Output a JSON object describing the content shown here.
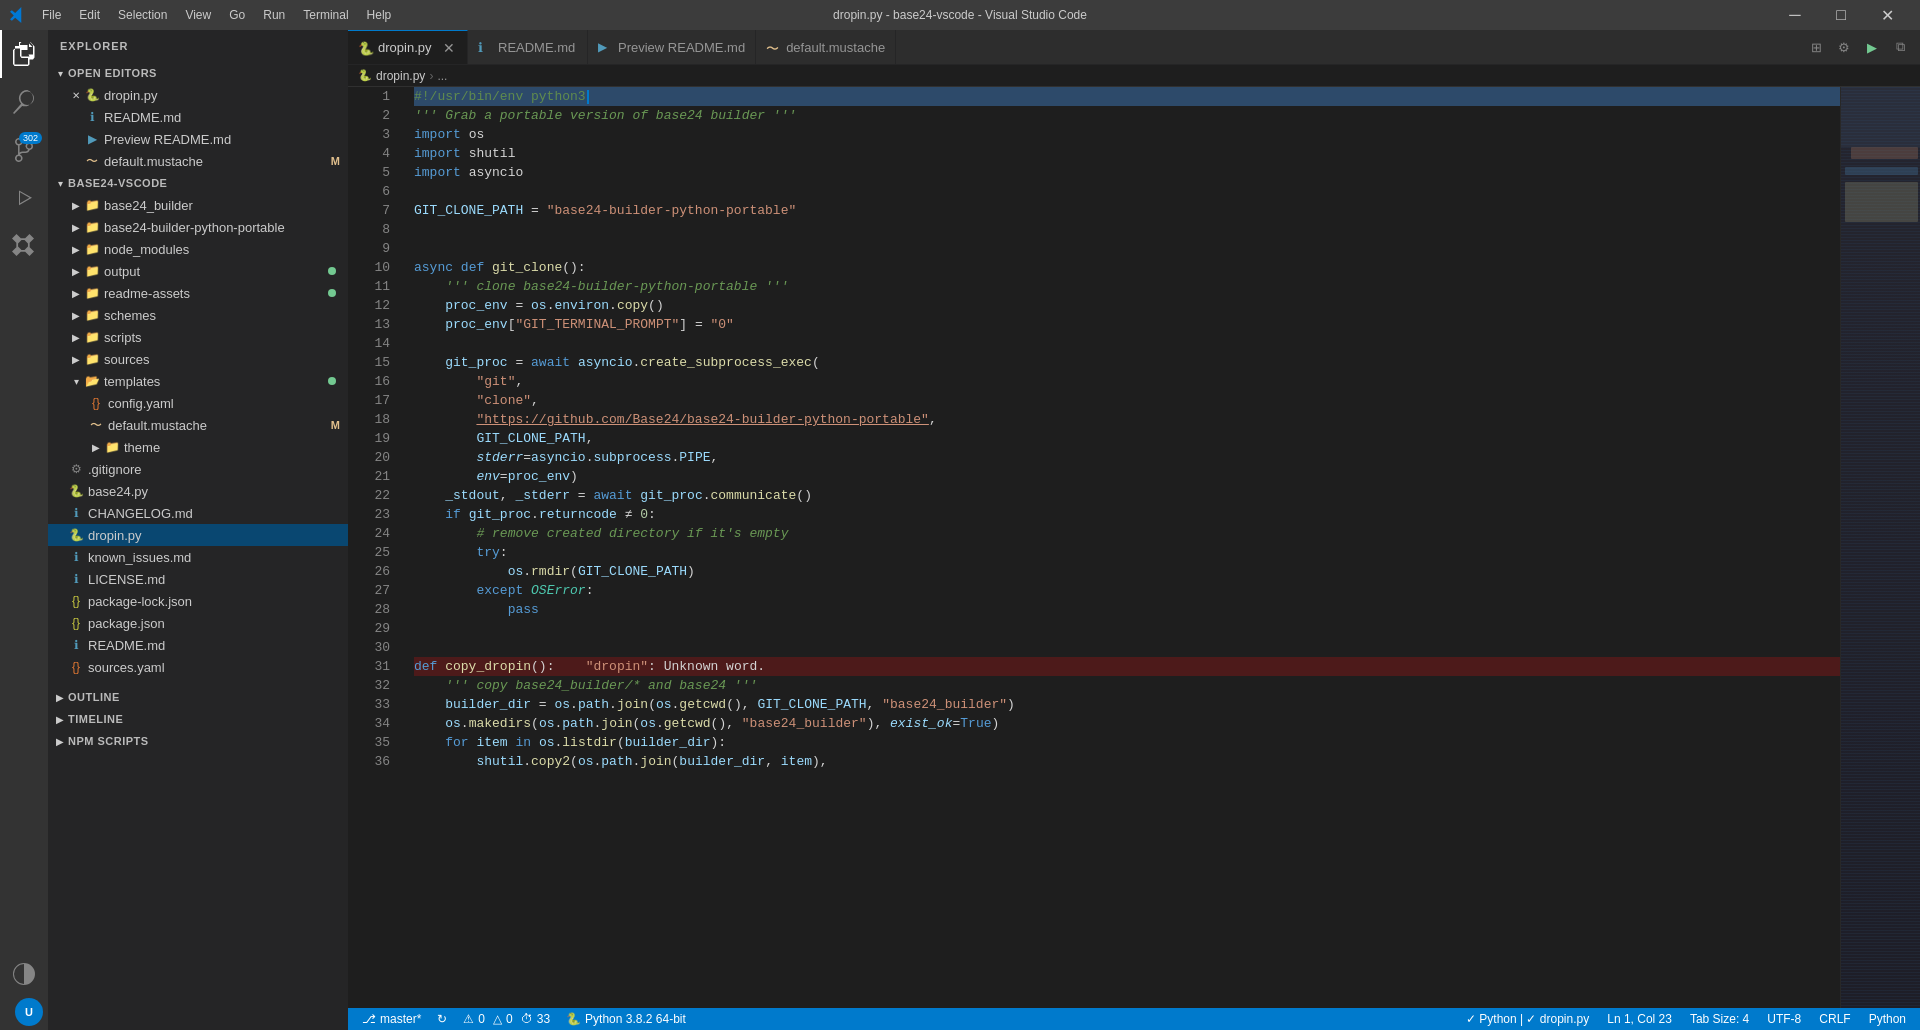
{
  "titlebar": {
    "title": "dropin.py - base24-vscode - Visual Studio Code",
    "menu": [
      "File",
      "Edit",
      "Selection",
      "View",
      "Go",
      "Run",
      "Terminal",
      "Help"
    ],
    "controls": [
      "─",
      "□",
      "✕"
    ]
  },
  "activity_bar": {
    "items": [
      {
        "name": "explorer",
        "icon": "files",
        "active": true
      },
      {
        "name": "search",
        "icon": "search"
      },
      {
        "name": "source-control",
        "icon": "git",
        "badge": "302"
      },
      {
        "name": "run-debug",
        "icon": "run"
      },
      {
        "name": "extensions",
        "icon": "extensions"
      },
      {
        "name": "remote-explorer",
        "icon": "remote"
      }
    ]
  },
  "sidebar": {
    "header": "EXPLORER",
    "open_editors": {
      "label": "OPEN EDITORS",
      "items": [
        {
          "name": "dropin.py",
          "type": "python",
          "active": true
        },
        {
          "name": "README.md",
          "type": "markdown"
        },
        {
          "name": "Preview README.md",
          "type": "preview"
        },
        {
          "name": "default.mustache",
          "type": "mustache",
          "badge": "M"
        }
      ]
    },
    "project": {
      "label": "BASE24-VSCODE",
      "folders": [
        {
          "name": "base24_builder",
          "indent": 1
        },
        {
          "name": "base24-builder-python-portable",
          "indent": 1
        },
        {
          "name": "node_modules",
          "indent": 1
        },
        {
          "name": "output",
          "indent": 1,
          "dot": "#73c991"
        },
        {
          "name": "readme-assets",
          "indent": 1,
          "dot": "#73c991"
        },
        {
          "name": "schemes",
          "indent": 1
        },
        {
          "name": "scripts",
          "indent": 1
        },
        {
          "name": "sources",
          "indent": 1
        },
        {
          "name": "templates",
          "indent": 1,
          "expanded": true,
          "dot": "#73c991"
        },
        {
          "name": "config.yaml",
          "indent": 2,
          "type": "yaml"
        },
        {
          "name": "default.mustache",
          "indent": 2,
          "type": "mustache",
          "badge": "M"
        },
        {
          "name": "theme",
          "indent": 2,
          "type": "folder-expanded"
        },
        {
          "name": ".gitignore",
          "indent": 1,
          "type": "gitignore"
        },
        {
          "name": "base24.py",
          "indent": 1,
          "type": "python"
        },
        {
          "name": "CHANGELOG.md",
          "indent": 1,
          "type": "markdown"
        },
        {
          "name": "dropin.py",
          "indent": 1,
          "type": "python",
          "selected": true
        },
        {
          "name": "known_issues.md",
          "indent": 1,
          "type": "markdown"
        },
        {
          "name": "LICENSE.md",
          "indent": 1,
          "type": "markdown"
        },
        {
          "name": "package-lock.json",
          "indent": 1,
          "type": "json"
        },
        {
          "name": "package.json",
          "indent": 1,
          "type": "json"
        },
        {
          "name": "README.md",
          "indent": 1,
          "type": "markdown"
        },
        {
          "name": "sources.yaml",
          "indent": 1,
          "type": "yaml"
        }
      ]
    },
    "outline": {
      "label": "OUTLINE"
    },
    "timeline": {
      "label": "TIMELINE"
    },
    "npm_scripts": {
      "label": "NPM SCRIPTS"
    }
  },
  "tabs": [
    {
      "label": "dropin.py",
      "type": "python",
      "active": true,
      "closable": true
    },
    {
      "label": "README.md",
      "type": "markdown",
      "active": false
    },
    {
      "label": "Preview README.md",
      "type": "preview",
      "active": false
    },
    {
      "label": "default.mustache",
      "type": "mustache",
      "active": false
    }
  ],
  "breadcrumb": [
    "dropin.py",
    "..."
  ],
  "code": {
    "lines": [
      {
        "n": 1,
        "content": "shebang",
        "text": "#!/usr/bin/env python3"
      },
      {
        "n": 2,
        "content": "comment",
        "text": "''' Grab a portable version of base24 builder '''"
      },
      {
        "n": 3,
        "content": "import",
        "text": "import os"
      },
      {
        "n": 4,
        "content": "import",
        "text": "import shutil"
      },
      {
        "n": 5,
        "content": "import",
        "text": "import asyncio"
      },
      {
        "n": 6,
        "content": "blank"
      },
      {
        "n": 7,
        "content": "assign",
        "text": "GIT_CLONE_PATH = \"base24-builder-python-portable\""
      },
      {
        "n": 8,
        "content": "blank"
      },
      {
        "n": 9,
        "content": "blank"
      },
      {
        "n": 10,
        "content": "funcdef",
        "text": "async def git_clone():"
      },
      {
        "n": 11,
        "content": "docstring",
        "text": "    ''' clone base24-builder-python-portable '''"
      },
      {
        "n": 12,
        "content": "assign2",
        "text": "    proc_env = os.environ.copy()"
      },
      {
        "n": 13,
        "content": "assign3",
        "text": "    proc_env[\"GIT_TERMINAL_PROMPT\"] = \"0\""
      },
      {
        "n": 14,
        "content": "blank"
      },
      {
        "n": 15,
        "content": "assign4",
        "text": "    git_proc = await asyncio.create_subprocess_exec("
      },
      {
        "n": 16,
        "content": "str1",
        "text": "        \"git\","
      },
      {
        "n": 17,
        "content": "str2",
        "text": "        \"clone\","
      },
      {
        "n": 18,
        "content": "str3",
        "text": "        \"https://github.com/Base24/base24-builder-python-portable\","
      },
      {
        "n": 19,
        "content": "var1",
        "text": "        GIT_CLONE_PATH,"
      },
      {
        "n": 20,
        "content": "kw1",
        "text": "        stderr=asyncio.subprocess.PIPE,"
      },
      {
        "n": 21,
        "content": "kw2",
        "text": "        env=proc_env)"
      },
      {
        "n": 22,
        "content": "unpack",
        "text": "    _stdout, _stderr = await git_proc.communicate()"
      },
      {
        "n": 23,
        "content": "if1",
        "text": "    if git_proc.returncode ≠ 0:"
      },
      {
        "n": 24,
        "content": "comment2",
        "text": "        # remove created directory if it's empty"
      },
      {
        "n": 25,
        "content": "try1",
        "text": "        try:"
      },
      {
        "n": 26,
        "content": "rmdir",
        "text": "            os.rmdir(GIT_CLONE_PATH)"
      },
      {
        "n": 27,
        "content": "except1",
        "text": "        except OSError:"
      },
      {
        "n": 28,
        "content": "pass1",
        "text": "            pass"
      },
      {
        "n": 29,
        "content": "blank"
      },
      {
        "n": 30,
        "content": "blank"
      },
      {
        "n": 31,
        "content": "funcdef2",
        "text": "def copy_dropin():    \"dropin\": Unknown word.",
        "error": true
      },
      {
        "n": 32,
        "content": "docstring2",
        "text": "    ''' copy base24_builder/* and base24 '''"
      },
      {
        "n": 33,
        "content": "assign5",
        "text": "    builder_dir = os.path.join(os.getcwd(), GIT_CLONE_PATH, \"base24_builder\")"
      },
      {
        "n": 34,
        "content": "makedirs",
        "text": "    os.makedirs(os.path.join(os.getcwd(), \"base24_builder\"), exist_ok=True)"
      },
      {
        "n": 35,
        "content": "for1",
        "text": "    for item in os.listdir(builder_dir):"
      },
      {
        "n": 36,
        "content": "copy1",
        "text": "        shutil.copy2(os.path.join(builder_dir, item),"
      }
    ]
  },
  "status_bar": {
    "left": [
      {
        "icon": "git-branch",
        "text": "master*"
      },
      {
        "icon": "refresh"
      },
      {
        "icon": "warning",
        "text": "0"
      },
      {
        "icon": "triangle",
        "text": "0"
      },
      {
        "icon": "clock",
        "text": "33"
      }
    ],
    "right": [
      {
        "text": "Ln 1, Col 23"
      },
      {
        "text": "Tab Size: 4"
      },
      {
        "text": "UTF-8"
      },
      {
        "text": "CRLF"
      },
      {
        "text": "Python"
      }
    ],
    "bottom_left": [
      {
        "icon": "remote",
        "text": "master*"
      },
      {
        "icon": "python",
        "text": "Python 3.8.2 64-bit"
      },
      {
        "text": "⚠ 0  ⚐ 0  ⏱ 33"
      }
    ],
    "bottom_right": [
      {
        "text": "✓ Python | ✓ dropin.py"
      }
    ]
  }
}
